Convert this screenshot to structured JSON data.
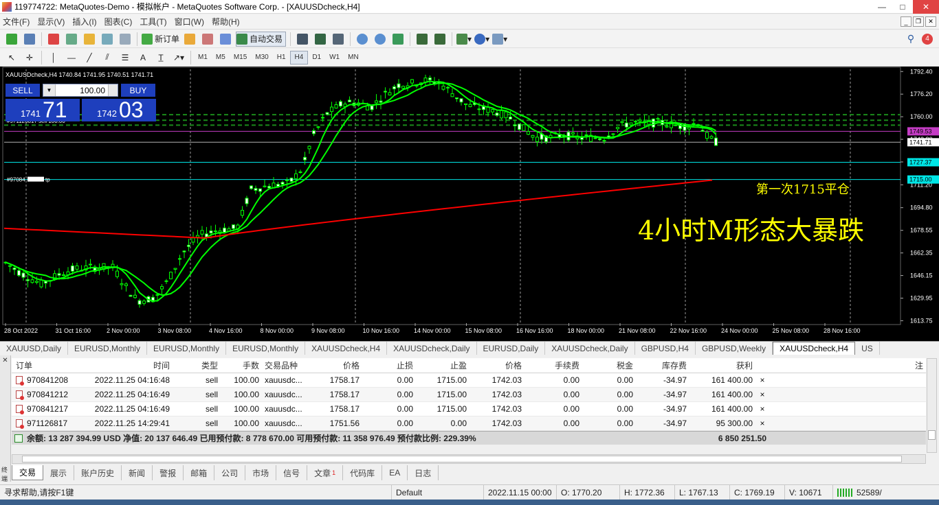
{
  "window": {
    "title": "119774722: MetaQuotes-Demo - 模拟帐户 - MetaQuotes Software Corp. - [XAUUSDcheck,H4]",
    "controls": [
      "—",
      "□",
      "✕"
    ]
  },
  "menu": [
    "文件(F)",
    "显示(V)",
    "插入(I)",
    "图表(C)",
    "工具(T)",
    "窗口(W)",
    "帮助(H)"
  ],
  "toolbar": {
    "new_order_label": "新订单",
    "autotrading_label": "自动交易",
    "notification_count": "4"
  },
  "timeframes": [
    "M1",
    "M5",
    "M15",
    "M30",
    "H1",
    "H4",
    "D1",
    "W1",
    "MN"
  ],
  "active_timeframe": "H4",
  "chart": {
    "symbol_info": "XAUUSDcheck,H4  1740.84 1741.95 1740.51 1741.71",
    "sell_label": "SELL",
    "buy_label": "BUY",
    "volume": "100.00",
    "bid_small": "1741",
    "bid_big": "71",
    "ask_small": "1742",
    "ask_big": "03",
    "order_line_1": "#971126817 sell 100.00",
    "order_line_2": "#97084",
    "order_line_2_tail": "tp",
    "annotation_small": "第一次1715平仓",
    "annotation_big": "4小时M形态大暴跌",
    "price_ticks": [
      "1792.40",
      "1776.20",
      "1760.00",
      "1743.80",
      "1727.60",
      "1711.20",
      "1694.80",
      "1678.55",
      "1662.35",
      "1646.15",
      "1629.95",
      "1613.75"
    ],
    "price_tags": [
      {
        "label": "1749.53",
        "value": 1749.53,
        "color": "#c43cc4"
      },
      {
        "label": "1741.71",
        "value": 1741.71,
        "color": "#ffffff"
      },
      {
        "label": "1727.37",
        "value": 1727.37,
        "color": "#00e6e6"
      },
      {
        "label": "1715.00",
        "value": 1715.0,
        "color": "#00e6e6"
      }
    ],
    "time_ticks": [
      "28 Oct 2022",
      "31 Oct 16:00",
      "2 Nov 00:00",
      "3 Nov 08:00",
      "4 Nov 16:00",
      "8 Nov 00:00",
      "9 Nov 08:00",
      "10 Nov 16:00",
      "14 Nov 00:00",
      "15 Nov 08:00",
      "16 Nov 16:00",
      "18 Nov 00:00",
      "21 Nov 08:00",
      "22 Nov 16:00",
      "24 Nov 00:00",
      "25 Nov 08:00",
      "28 Nov 16:00"
    ]
  },
  "chart_tabs": [
    "XAUUSD,Daily",
    "EURUSD,Monthly",
    "EURUSD,Monthly",
    "EURUSD,Monthly",
    "XAUUSDcheck,H4",
    "XAUUSDcheck,Daily",
    "EURUSD,Daily",
    "XAUUSDcheck,Daily",
    "GBPUSD,H4",
    "GBPUSD,Weekly",
    "XAUUSDcheck,H4",
    "US"
  ],
  "active_chart_tab": 10,
  "terminal": {
    "columns": [
      "订单",
      "时间",
      "类型",
      "手数",
      "交易品种",
      "价格",
      "止损",
      "止盈",
      "价格",
      "手续费",
      "税金",
      "库存费",
      "获利",
      "",
      "注"
    ],
    "rows": [
      [
        "970841208",
        "2022.11.25 04:16:48",
        "sell",
        "100.00",
        "xauusdc...",
        "1758.17",
        "0.00",
        "1715.00",
        "1742.03",
        "0.00",
        "0.00",
        "-34.97",
        "161 400.00",
        "×"
      ],
      [
        "970841212",
        "2022.11.25 04:16:49",
        "sell",
        "100.00",
        "xauusdc...",
        "1758.17",
        "0.00",
        "1715.00",
        "1742.03",
        "0.00",
        "0.00",
        "-34.97",
        "161 400.00",
        "×"
      ],
      [
        "970841217",
        "2022.11.25 04:16:49",
        "sell",
        "100.00",
        "xauusdc...",
        "1758.17",
        "0.00",
        "1715.00",
        "1742.03",
        "0.00",
        "0.00",
        "-34.97",
        "161 400.00",
        "×"
      ],
      [
        "971126817",
        "2022.11.25 14:29:41",
        "sell",
        "100.00",
        "xauusdc...",
        "1751.56",
        "0.00",
        "0.00",
        "1742.03",
        "0.00",
        "0.00",
        "-34.97",
        "95 300.00",
        "×"
      ]
    ],
    "summary": "余额: 13 287 394.99 USD  净值: 20 137 646.49  已用预付款: 8 778 670.00  可用预付款: 11 358 976.49  预付款比例: 229.39%",
    "summary_profit": "6 850 251.50",
    "side_label": "终端",
    "tabs": [
      {
        "label": "交易",
        "badge": ""
      },
      {
        "label": "展示",
        "badge": ""
      },
      {
        "label": "账户历史",
        "badge": ""
      },
      {
        "label": "新闻",
        "badge": ""
      },
      {
        "label": "警报",
        "badge": ""
      },
      {
        "label": "邮箱",
        "badge": ""
      },
      {
        "label": "公司",
        "badge": ""
      },
      {
        "label": "市场",
        "badge": ""
      },
      {
        "label": "信号",
        "badge": ""
      },
      {
        "label": "文章",
        "badge": "1"
      },
      {
        "label": "代码库",
        "badge": ""
      },
      {
        "label": "EA",
        "badge": ""
      },
      {
        "label": "日志",
        "badge": ""
      }
    ]
  },
  "status": {
    "help": "寻求帮助,请按F1键",
    "profile": "Default",
    "datetime": "2022.11.15 00:00",
    "open": "O: 1770.20",
    "high": "H: 1772.36",
    "low": "L: 1767.13",
    "close": "C: 1769.19",
    "volume": "V: 10671",
    "traffic": "52589/"
  },
  "colors": {
    "chart_bg": "#000000",
    "candle": "#00ff00",
    "ma_fast": "#00ff00",
    "ma_slow": "#ff0000",
    "annotation": "#ffff00",
    "sell_buy_bg": "#1e3fbd"
  }
}
